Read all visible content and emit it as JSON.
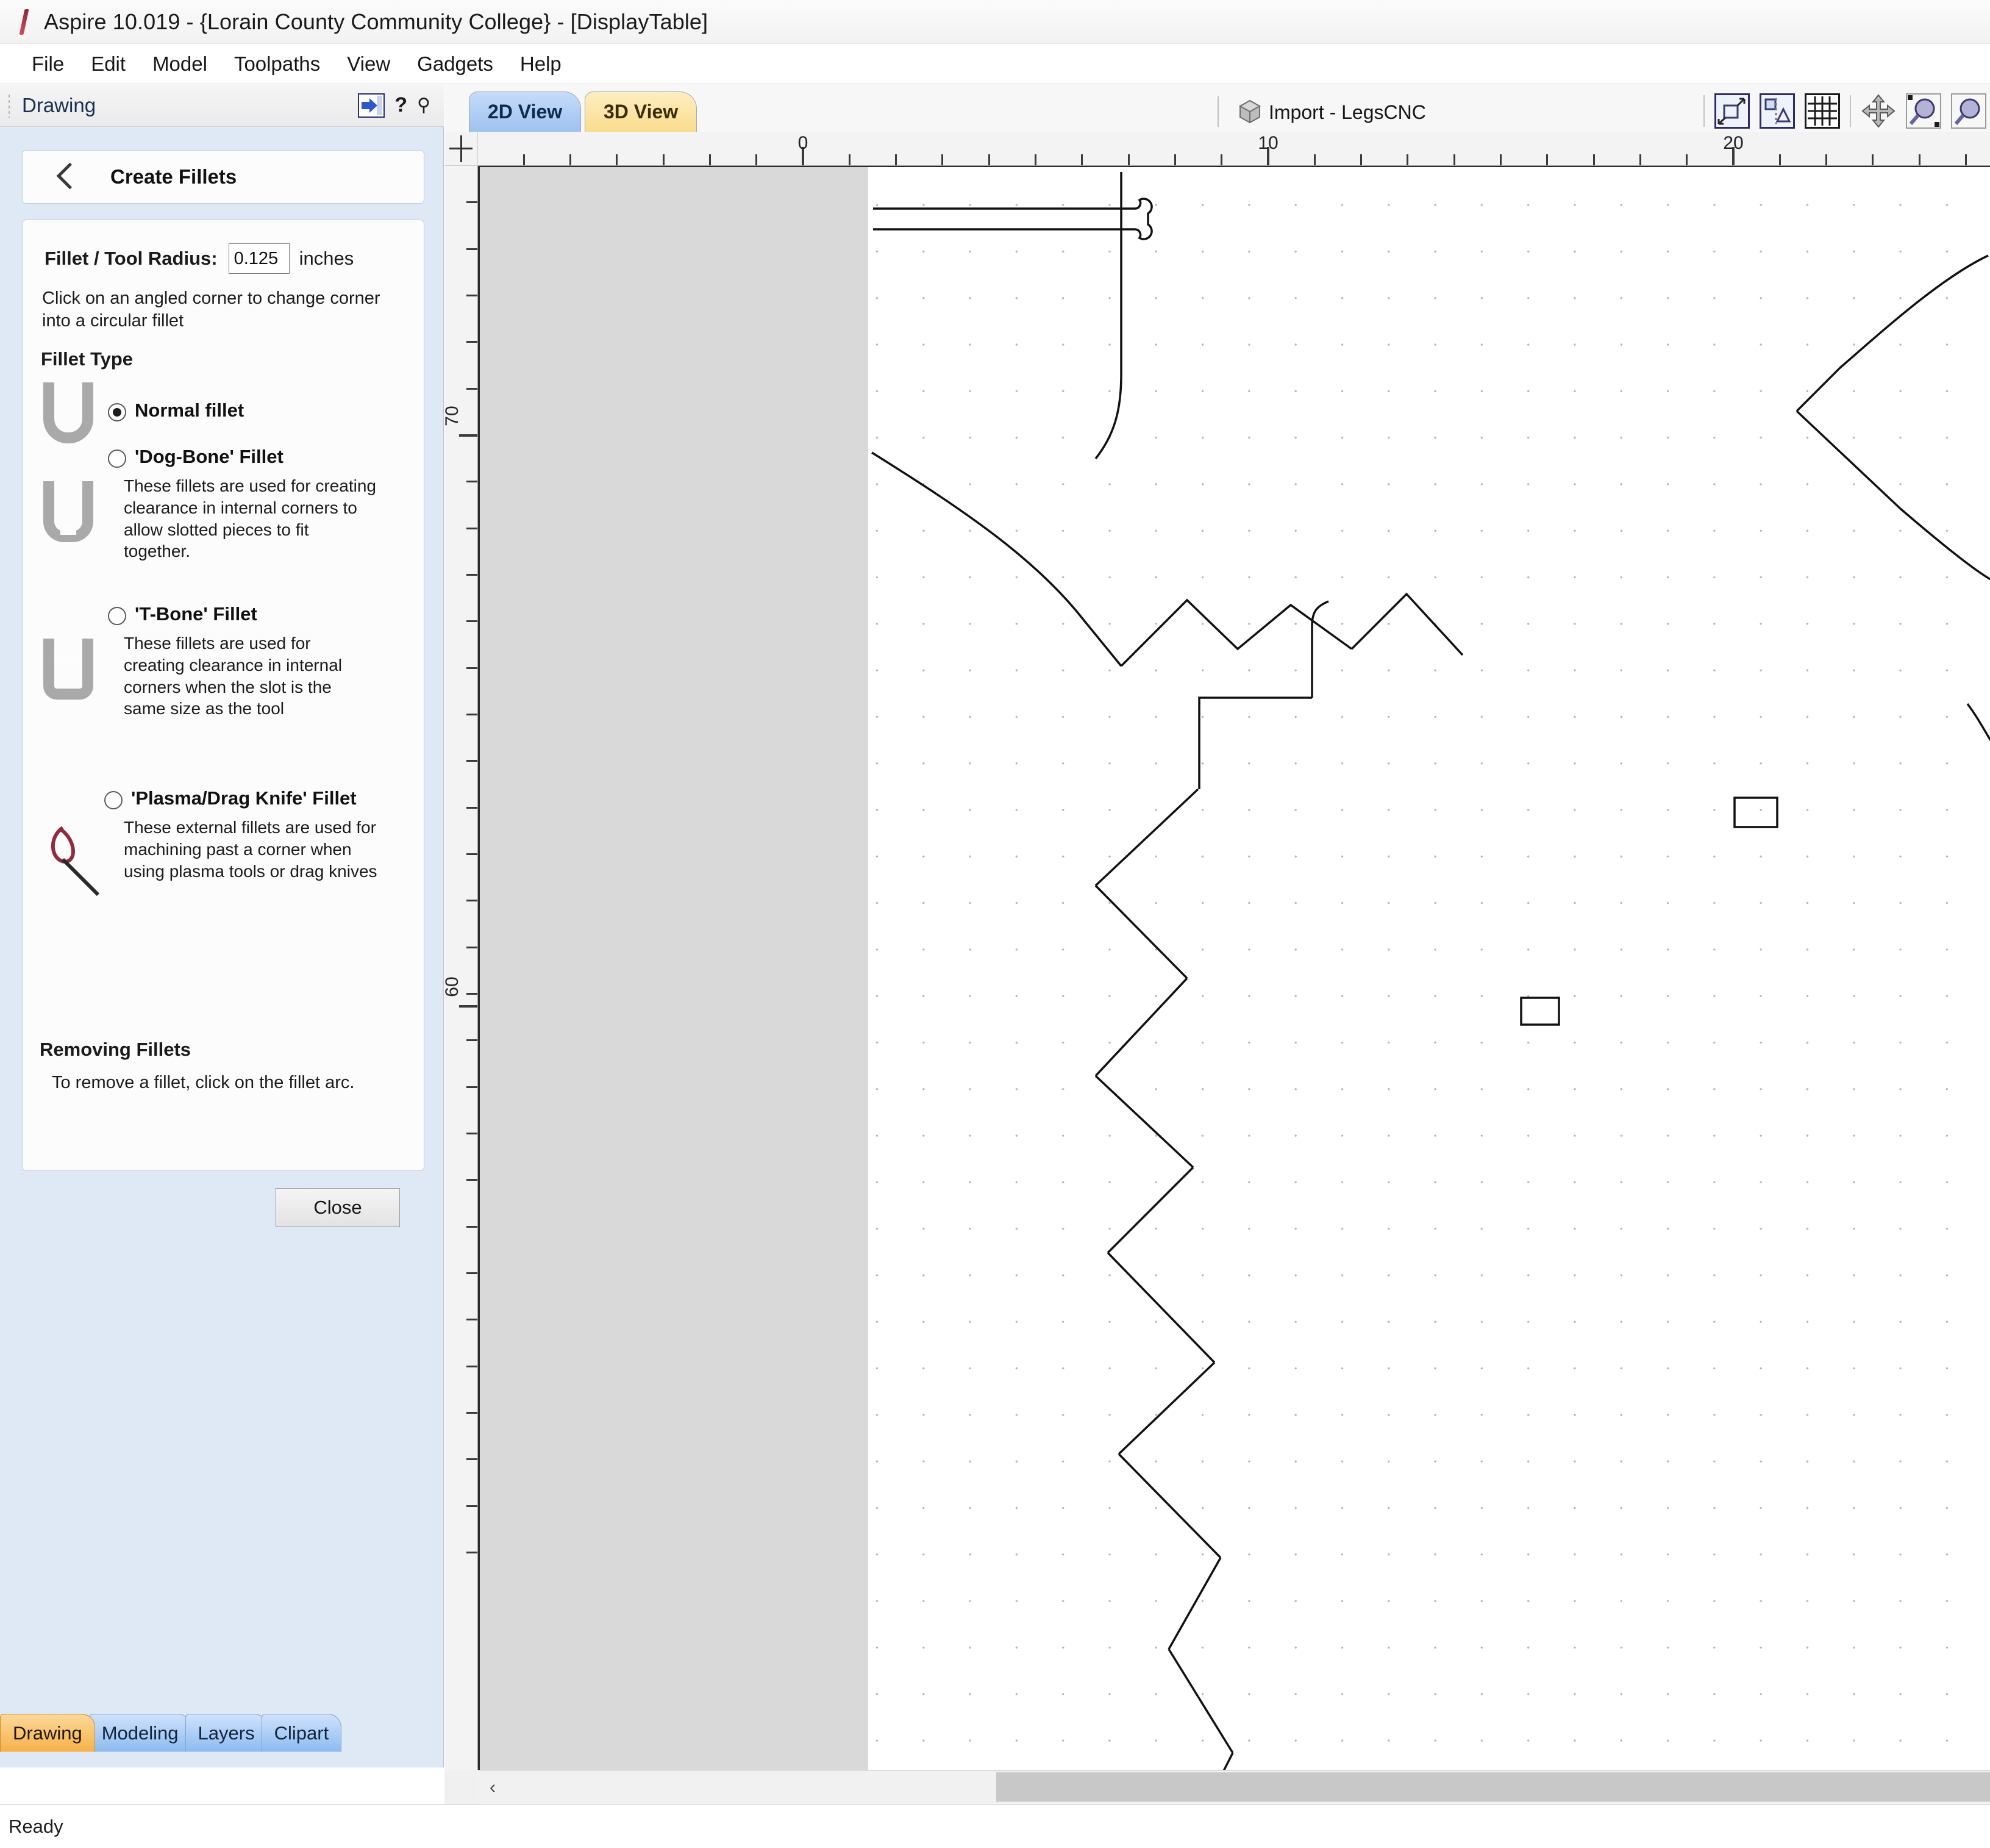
{
  "window": {
    "title": "Aspire 10.019 - {Lorain County Community College} - [DisplayTable]",
    "logo_icon": "aspire-logo-icon"
  },
  "menubar": {
    "items": [
      {
        "label": "File"
      },
      {
        "label": "Edit"
      },
      {
        "label": "Model"
      },
      {
        "label": "Toolpaths"
      },
      {
        "label": "View"
      },
      {
        "label": "Gadgets"
      },
      {
        "label": "Help"
      }
    ]
  },
  "left_panel": {
    "header": {
      "title": "Drawing",
      "grip_icon": "drag-grip-icon",
      "autohide_icon": "auto-hide-panel-icon",
      "help_icon": "help-question-icon",
      "pin_icon": "pushpin-icon"
    },
    "form_title": "Create Fillets",
    "back_icon": "back-chevron-icon",
    "radius": {
      "label": "Fillet / Tool Radius:",
      "value": "0.125",
      "placeholder": "0.125",
      "units": "inches"
    },
    "hint": "Click on an angled corner to change corner into a circular fillet",
    "fillet_type_heading": "Fillet Type",
    "fillet_options": [
      {
        "id": "normal",
        "label": "Normal fillet",
        "selected": true,
        "description": "",
        "thumb_icon": "normal-fillet-thumb-icon"
      },
      {
        "id": "dog-bone",
        "label": "'Dog-Bone' Fillet",
        "selected": false,
        "description": "These fillets are used for creating clearance in internal corners to allow slotted pieces to fit together.",
        "thumb_icon": "dog-bone-fillet-thumb-icon"
      },
      {
        "id": "t-bone",
        "label": "'T-Bone' Fillet",
        "selected": false,
        "description": "These fillets are used for creating clearance in internal corners when the slot is the same size as the tool",
        "thumb_icon": "t-bone-fillet-thumb-icon"
      },
      {
        "id": "plasma-drag-knife",
        "label": "'Plasma/Drag Knife' Fillet",
        "selected": false,
        "description": "These external fillets are used for machining past a corner when using plasma tools or drag knives",
        "thumb_icon": "plasma-drag-knife-thumb-icon"
      }
    ],
    "removing_heading": "Removing Fillets",
    "removing_text": "To remove a fillet, click on the fillet arc.",
    "close_label": "Close",
    "bottom_tabs": [
      {
        "label": "Drawing",
        "active": true
      },
      {
        "label": "Modeling",
        "active": false
      },
      {
        "label": "Layers",
        "active": false
      },
      {
        "label": "Clipart",
        "active": false
      }
    ]
  },
  "canvas": {
    "tabs": [
      {
        "label": "2D View",
        "active": true
      },
      {
        "label": "3D View",
        "active": false
      }
    ],
    "job_icon": "job-cube-icon",
    "job_label": "Import - LegsCNC",
    "toolbar_icons": [
      {
        "name": "zoom-to-selection-icon"
      },
      {
        "name": "zoom-to-drawing-icon"
      },
      {
        "name": "toggle-grid-icon"
      },
      {
        "name": "pan-view-icon"
      },
      {
        "name": "zoom-in-icon"
      },
      {
        "name": "zoom-out-icon"
      }
    ],
    "rulers": {
      "top_labels": [
        "0",
        "10",
        "20"
      ],
      "left_labels": [
        "70",
        "60"
      ]
    },
    "scrollbar": {
      "left_arrow_icon": "chevron-left-icon"
    }
  },
  "statusbar": {
    "text": "Ready"
  },
  "colors": {
    "accent_blue": "#9dc2ef",
    "accent_orange": "#f6b24a",
    "panel_background": "#dfe9f5",
    "material_outside": "#d9d9d9",
    "geometry_stroke": "#111111"
  }
}
